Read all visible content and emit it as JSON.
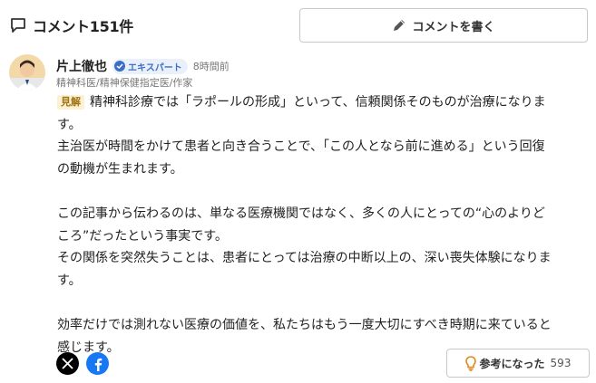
{
  "header": {
    "title": "コメント151件",
    "write_button": "コメントを書く"
  },
  "author": {
    "name": "片上徹也",
    "badge": "エキスパート",
    "time": "8時間前",
    "role": "精神科医/精神保健指定医/作家"
  },
  "comment": {
    "tag": "見解",
    "lines": [
      "精神科診療では「ラポールの形成」といって、信頼関係そのものが治療になりま",
      "す。",
      "主治医が時間をかけて患者と向き合うことで、「この人となら前に進める」という回復",
      "の動機が生まれます。",
      "",
      "この記事から伝わるのは、単なる医療機関ではなく、多くの人にとっての“心のよりど",
      "ころ”だったという事実です。",
      "その関係を突然失うことは、患者にとっては治療の中断以上の、深い喪失体験になりま",
      "す。",
      "",
      "効率だけでは測れない医療の価値を、私たちはもう一度大切にすべき時期に来ていると",
      "感じます。"
    ]
  },
  "footer": {
    "useful_label": "参考になった",
    "useful_count": "593"
  },
  "colors": {
    "accent_blue": "#3a6fc4",
    "tag_bg": "#fdf1d4",
    "facebook": "#1877f2"
  },
  "icons": [
    "comment-icon",
    "pencil-icon",
    "verified-check-icon",
    "x-logo-icon",
    "facebook-logo-icon",
    "lightbulb-icon"
  ]
}
